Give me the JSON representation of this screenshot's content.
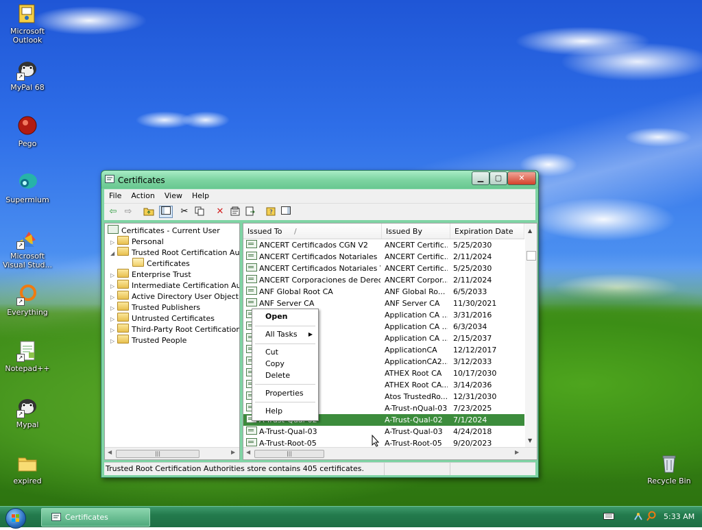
{
  "desktop": {
    "icons": [
      {
        "label": "Microsoft Outlook",
        "icon": "outlook-icon"
      },
      {
        "label": "MyPal 68",
        "icon": "mypal-icon"
      },
      {
        "label": "Pego",
        "icon": "pego-icon"
      },
      {
        "label": "Supermium",
        "icon": "supermium-icon"
      },
      {
        "label": "Microsoft Visual Stud...",
        "icon": "visual-studio-icon"
      },
      {
        "label": "Everything",
        "icon": "everything-icon"
      },
      {
        "label": "Notepad++",
        "icon": "notepad-plus-plus-icon"
      },
      {
        "label": "Mypal",
        "icon": "mypal-icon"
      },
      {
        "label": "expired",
        "icon": "folder-icon"
      },
      {
        "label": "Recycle Bin",
        "icon": "recycle-bin-icon"
      }
    ]
  },
  "window": {
    "title": "Certificates",
    "menu": [
      "File",
      "Action",
      "View",
      "Help"
    ],
    "toolbar_icons": [
      "back-icon",
      "forward-icon",
      "up-folder-icon",
      "show-hide-tree-icon",
      "cut-icon",
      "copy-icon",
      "delete-icon",
      "properties-icon",
      "export-list-icon",
      "help-icon",
      "show-hide-action-pane-icon"
    ],
    "tree": {
      "root": "Certificates - Current User",
      "items": [
        "Personal",
        "Trusted Root Certification Aut",
        "Certificates",
        "Enterprise Trust",
        "Intermediate Certification Aut",
        "Active Directory User Object",
        "Trusted Publishers",
        "Untrusted Certificates",
        "Third-Party Root Certification",
        "Trusted People"
      ]
    },
    "list": {
      "columns": [
        "Issued To",
        "Issued By",
        "Expiration Date"
      ],
      "sort_indicator": "/",
      "rows": [
        [
          "ANCERT Certificados CGN V2",
          "ANCERT Certific...",
          "5/25/2030"
        ],
        [
          "ANCERT Certificados Notariales",
          "ANCERT Certific...",
          "2/11/2024"
        ],
        [
          "ANCERT Certificados Notariales V2",
          "ANCERT Certific...",
          "5/25/2030"
        ],
        [
          "ANCERT Corporaciones de Derec...",
          "ANCERT Corpor...",
          "2/11/2024"
        ],
        [
          "ANF Global Root CA",
          "ANF Global Ro...",
          "6/5/2033"
        ],
        [
          "ANF Server CA",
          "ANF Server CA",
          "11/30/2021"
        ],
        [
          "2",
          "Application CA ...",
          "3/31/2016"
        ],
        [
          "3 Root",
          "Application CA ...",
          "6/3/2034"
        ],
        [
          "4 Root",
          "Application CA ...",
          "2/15/2037"
        ],
        [
          "",
          "ApplicationCA",
          "12/12/2017"
        ],
        [
          "Root",
          "ApplicationCA2...",
          "3/12/2033"
        ],
        [
          "",
          "ATHEX Root CA",
          "10/17/2030"
        ],
        [
          "2",
          "ATHEX Root CA...",
          "3/14/2036"
        ],
        [
          "e 2011",
          "Atos TrustedRo...",
          "12/31/2030"
        ],
        [
          "3",
          "A-Trust-nQual-03",
          "7/23/2025"
        ],
        [
          "A-Trust-Qual-02",
          "A-Trust-Qual-02",
          "7/1/2024"
        ],
        [
          "A-Trust-Qual-03",
          "A-Trust-Qual-03",
          "4/24/2018"
        ],
        [
          "A-Trust-Root-05",
          "A-Trust-Root-05",
          "9/20/2023"
        ]
      ],
      "selected_index": 15
    },
    "status": "Trusted Root Certification Authorities store contains 405 certificates."
  },
  "context_menu": {
    "open": "Open",
    "all_tasks": "All Tasks",
    "cut": "Cut",
    "copy": "Copy",
    "delete": "Delete",
    "properties": "Properties",
    "help": "Help"
  },
  "taskbar": {
    "task_label": "Certificates",
    "clock": "5:33 AM"
  },
  "colors": {
    "title_green": "#7ed5a2",
    "selection_green": "#3c8c3c",
    "taskbar_green": "#237a4c"
  }
}
